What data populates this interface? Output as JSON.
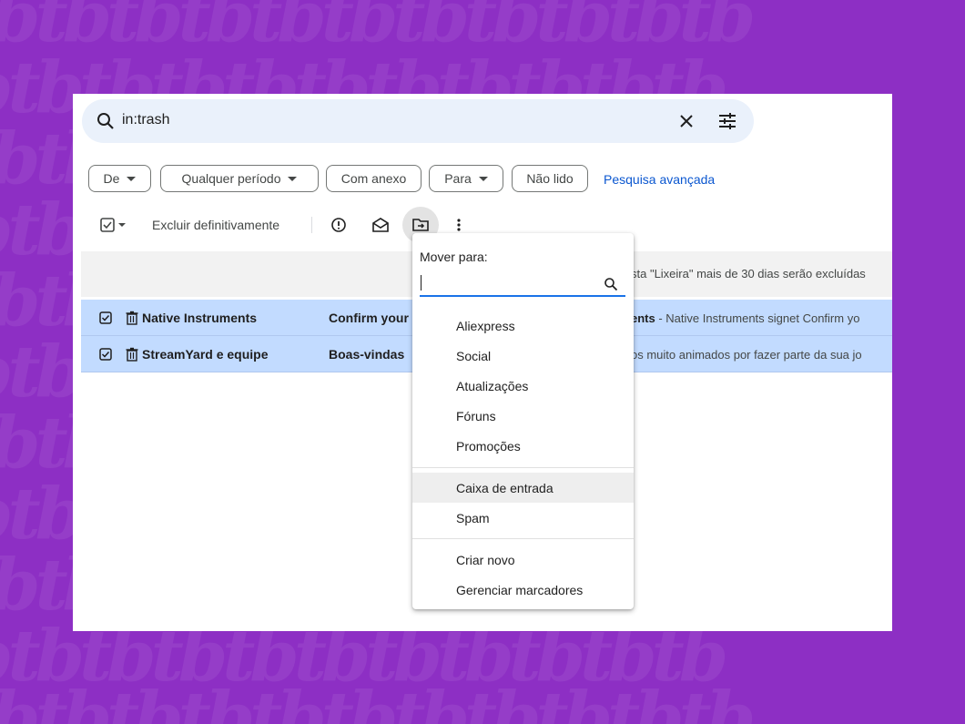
{
  "search": {
    "query": "in:trash"
  },
  "filters": {
    "from_label": "De",
    "period_label": "Qualquer período",
    "attachment_label": "Com anexo",
    "to_label": "Para",
    "unread_label": "Não lido",
    "advanced_link": "Pesquisa avançada"
  },
  "toolbar": {
    "delete_forever_label": "Excluir definitivamente"
  },
  "notice": {
    "text": "sta \"Lixeira\" mais de 30 dias serão excluídas"
  },
  "emails": [
    {
      "sender": "Native Instruments",
      "subject": "Confirm your",
      "snippet_bold": "ents",
      "snippet_rest": " - Native Instruments signet Confirm yo"
    },
    {
      "sender": "StreamYard e equipe",
      "subject": "Boas-vindas",
      "snippet_bold": "",
      "snippet_rest": "os muito animados por fazer parte da sua jo"
    }
  ],
  "move_menu": {
    "title": "Mover para:",
    "search_value": "",
    "labels": [
      "Aliexpress",
      "Social",
      "Atualizações",
      "Fóruns",
      "Promoções"
    ],
    "system": [
      "Caixa de entrada",
      "Spam"
    ],
    "actions": [
      "Criar novo",
      "Gerenciar marcadores"
    ],
    "highlighted": "Caixa de entrada"
  },
  "colors": {
    "background": "#8d2fc4",
    "selected_row": "#c2dbff",
    "link": "#0b57d0",
    "search_bar": "#eaf1fb"
  },
  "icons": {
    "search": "search-icon",
    "clear": "close-icon",
    "options": "tune-icon",
    "select_all": "checkbox-icon",
    "report_spam": "report-icon",
    "mark_unread": "envelope-icon",
    "move_to": "folder-move-icon",
    "more": "more-vert-icon",
    "trash": "trash-icon"
  }
}
